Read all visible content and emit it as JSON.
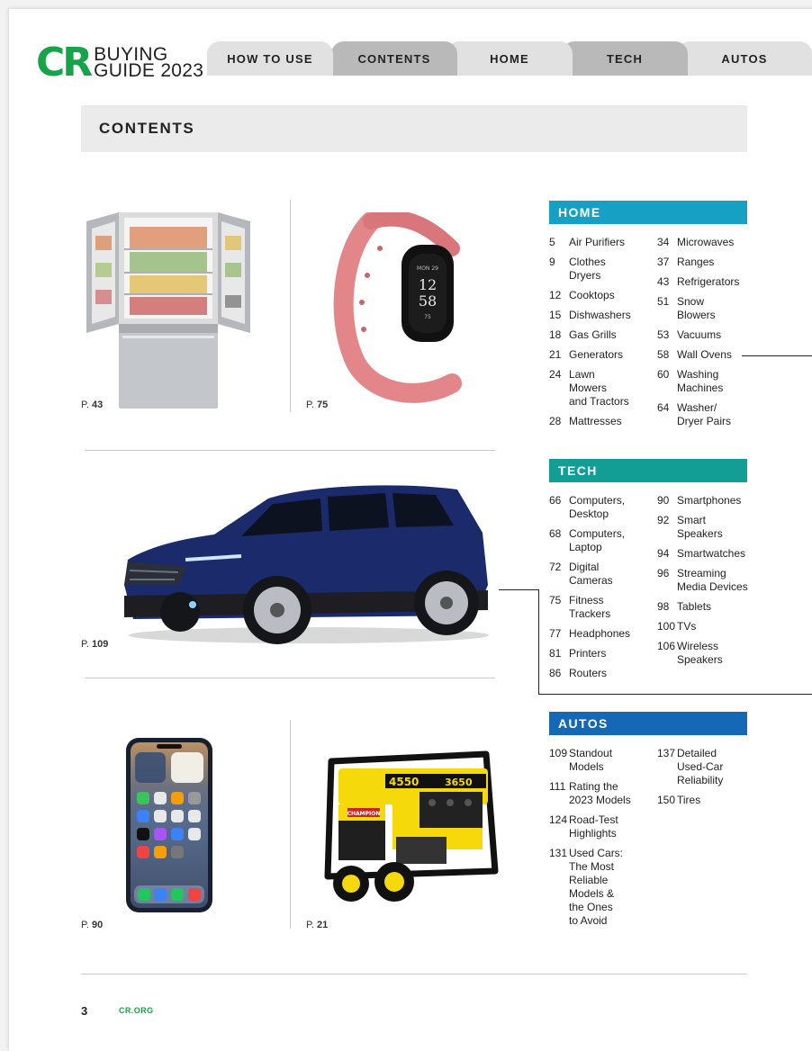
{
  "header": {
    "logo_mark": "CR",
    "logo_line1": "BUYING",
    "logo_line2": "GUIDE 2023",
    "tabs": [
      {
        "label": "HOW TO USE"
      },
      {
        "label": "CONTENTS"
      },
      {
        "label": "HOME"
      },
      {
        "label": "TECH"
      },
      {
        "label": "AUTOS"
      }
    ]
  },
  "page_title": "CONTENTS",
  "photos": [
    {
      "subject": "refrigerator",
      "caption_prefix": "P. ",
      "page": "43"
    },
    {
      "subject": "fitness-tracker",
      "caption_prefix": "P. ",
      "page": "75"
    },
    {
      "subject": "suv",
      "caption_prefix": "P. ",
      "page": "109"
    },
    {
      "subject": "smartphone",
      "caption_prefix": "P. ",
      "page": "90"
    },
    {
      "subject": "generator",
      "caption_prefix": "P. ",
      "page": "21"
    }
  ],
  "tracker_screen": {
    "line1": "MON 29",
    "time_h": "12",
    "time_m": "58",
    "line2": "75"
  },
  "generator_labels": {
    "starting": "4550",
    "running": "3650",
    "brand": "CHAMPION"
  },
  "sections": {
    "home": {
      "title": "HOME",
      "color": "#15a0c4",
      "left": [
        {
          "num": "5",
          "label": "Air Purifiers"
        },
        {
          "num": "9",
          "label": "Clothes\nDryers"
        },
        {
          "num": "12",
          "label": "Cooktops"
        },
        {
          "num": "15",
          "label": "Dishwashers"
        },
        {
          "num": "18",
          "label": "Gas Grills"
        },
        {
          "num": "21",
          "label": "Generators"
        },
        {
          "num": "24",
          "label": "Lawn\nMowers\nand Tractors"
        },
        {
          "num": "28",
          "label": "Mattresses"
        }
      ],
      "right": [
        {
          "num": "34",
          "label": "Microwaves"
        },
        {
          "num": "37",
          "label": "Ranges"
        },
        {
          "num": "43",
          "label": "Refrigerators"
        },
        {
          "num": "51",
          "label": "Snow\nBlowers"
        },
        {
          "num": "53",
          "label": "Vacuums"
        },
        {
          "num": "58",
          "label": "Wall Ovens"
        },
        {
          "num": "60",
          "label": "Washing\nMachines"
        },
        {
          "num": "64",
          "label": "Washer/\nDryer Pairs"
        }
      ]
    },
    "tech": {
      "title": "TECH",
      "color": "#129e95",
      "left": [
        {
          "num": "66",
          "label": "Computers,\nDesktop"
        },
        {
          "num": "68",
          "label": "Computers,\nLaptop"
        },
        {
          "num": "72",
          "label": "Digital\nCameras"
        },
        {
          "num": "75",
          "label": "Fitness\nTrackers"
        },
        {
          "num": "77",
          "label": "Headphones"
        },
        {
          "num": "81",
          "label": "Printers"
        },
        {
          "num": "86",
          "label": "Routers"
        }
      ],
      "right": [
        {
          "num": "90",
          "label": "Smartphones"
        },
        {
          "num": "92",
          "label": "Smart\nSpeakers"
        },
        {
          "num": "94",
          "label": "Smartwatches"
        },
        {
          "num": "96",
          "label": "Streaming\nMedia Devices"
        },
        {
          "num": "98",
          "label": "Tablets"
        },
        {
          "num": "100",
          "label": "TVs"
        },
        {
          "num": "106",
          "label": "Wireless\nSpeakers"
        }
      ]
    },
    "autos": {
      "title": "AUTOS",
      "color": "#1468b5",
      "left": [
        {
          "num": "109",
          "label": "Standout\nModels"
        },
        {
          "num": "111",
          "label": "Rating the\n2023 Models"
        },
        {
          "num": "124",
          "label": "Road-Test\nHighlights"
        },
        {
          "num": "131",
          "label": "Used Cars:\nThe Most\nReliable\nModels &\nthe Ones\nto Avoid"
        }
      ],
      "right": [
        {
          "num": "137",
          "label": "Detailed\nUsed-Car\nReliability"
        },
        {
          "num": "150",
          "label": "Tires"
        }
      ]
    }
  },
  "footer": {
    "page_number": "3",
    "site": "CR.ORG"
  }
}
